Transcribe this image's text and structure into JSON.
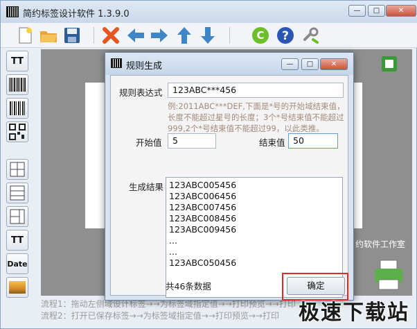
{
  "app": {
    "title": "简约标签设计软件  1.3.9.0",
    "window_controls": {
      "minimize": "—",
      "maximize": "□",
      "close": "✕"
    }
  },
  "toolbar": {
    "icons": [
      "new-file-icon",
      "open-folder-icon",
      "save-icon",
      "delete-icon",
      "arrow-left-icon",
      "arrow-right-icon",
      "arrow-up-icon",
      "arrow-down-icon",
      "copyright-icon",
      "help-icon",
      "link-icon"
    ]
  },
  "palette": {
    "items": [
      {
        "icon": "text-tool-icon",
        "label": "TT"
      },
      {
        "icon": "barcode-1d-icon"
      },
      {
        "icon": "barcode-icon"
      },
      {
        "icon": "qrcode-icon"
      },
      {
        "icon": "table-grid-icon"
      },
      {
        "icon": "table-rows-icon"
      },
      {
        "icon": "table-columns-icon"
      },
      {
        "icon": "text-box-icon",
        "label": "TT"
      },
      {
        "icon": "date-icon",
        "label": "Date"
      },
      {
        "icon": "image-icon"
      }
    ]
  },
  "canvas": {
    "studio_text": "约软件工作室"
  },
  "flow": {
    "line1": "流程1：拖动左侧域设计标签→→为标签域指定值→→打印预览→→打印",
    "line2": "流程2：打开已保存标签→→为标签域指定值→→打印预览→→打印"
  },
  "watermark": "极速下载站",
  "dialog": {
    "title": "规则生成",
    "rule_label": "规则表达式",
    "rule_value": "123ABC***456",
    "hint": "例:2011ABC***DEF,下面是*号的开始域结束值，长度不能超过星号的长度；3个*号结束值不能超过999,2个*号结束值不能超过99，以此类推。",
    "start_label": "开始值",
    "start_value": "5",
    "end_label": "结束值",
    "end_value": "50",
    "result_label": "生成结果",
    "results": [
      "123ABC005456",
      "123ABC006456",
      "123ABC007456",
      "123ABC008456",
      "123ABC009456",
      "...",
      "...",
      "123ABC050456"
    ],
    "count_text": "共46条数据",
    "ok_label": "确定"
  },
  "colors": {
    "highlight_box": "#e02a2a",
    "hint_text": "#a58a7c",
    "canvas_bg": "#8f8f8f"
  }
}
